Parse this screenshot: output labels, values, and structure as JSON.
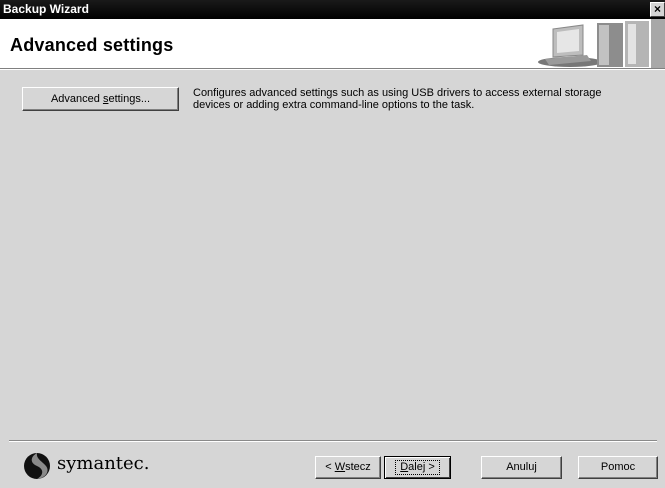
{
  "window": {
    "title": "Backup Wizard",
    "close_label": "×"
  },
  "header": {
    "title": "Advanced settings"
  },
  "main": {
    "advanced_button_pre": "Advanced ",
    "advanced_button_accel": "s",
    "advanced_button_post": "ettings...",
    "description_line1": "Configures advanced settings such as using USB drivers to access external storage",
    "description_line2": "devices or adding extra command-line options to the task."
  },
  "footer": {
    "logo_text": "symantec.",
    "back_pre": "< ",
    "back_accel": "W",
    "back_post": "stecz",
    "next_accel": "D",
    "next_post": "alej >",
    "cancel_label": "Anuluj",
    "help_label": "Pomoc"
  }
}
